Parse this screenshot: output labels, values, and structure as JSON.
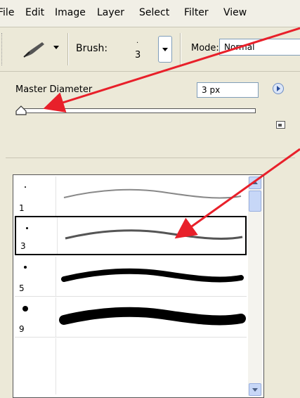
{
  "menubar": {
    "items": [
      "File",
      "Edit",
      "Image",
      "Layer",
      "Select",
      "Filter",
      "View"
    ]
  },
  "toolbar": {
    "tool_icon": "paintbrush-icon",
    "brush_label": "Brush:",
    "brush_dot": ".",
    "brush_size": "3",
    "mode_label": "Mode:",
    "mode_value": "Normal"
  },
  "panel": {
    "master_diameter_label": "Master Diameter",
    "master_diameter_value": "3 px",
    "slider_value_fraction": 0.0,
    "menu_icon": "right-arrow-icon",
    "new_preset_icon": "new-preset-icon"
  },
  "brush_list": [
    {
      "size": "1",
      "dot_char": "·"
    },
    {
      "size": "3",
      "dot_char": "·",
      "selected": true
    },
    {
      "size": "5",
      "dot_char": "·"
    },
    {
      "size": "9",
      "dot_char": "●"
    }
  ],
  "colors": {
    "annotation_arrow": "#e8202a",
    "panel_bg": "#ece9d8",
    "input_border": "#7f9db9"
  }
}
